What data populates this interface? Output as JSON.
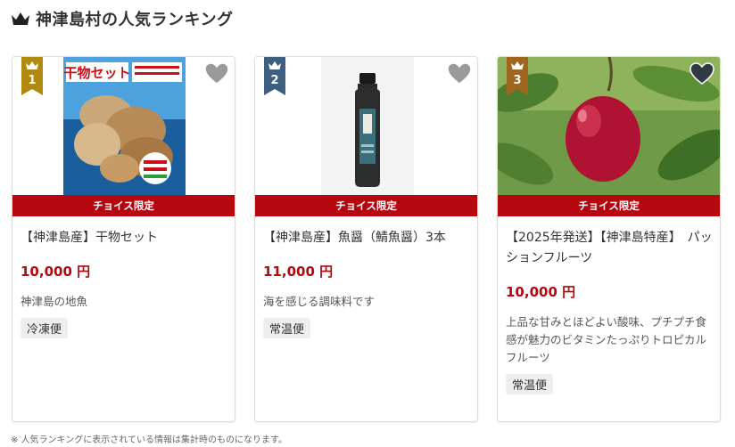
{
  "heading": "神津島村の人気ランキング",
  "ribbon_label": "チョイス限定",
  "products": [
    {
      "rank": "1",
      "rank_color": "#b08a0e",
      "title": "【神津島産】干物セット",
      "price": "10,000 円",
      "description": "神津島の地魚",
      "tag": "冷凍便",
      "image_text": "干物セット"
    },
    {
      "rank": "2",
      "rank_color": "#3e5f7f",
      "title": "【神津島産】魚醤（鯖魚醤）3本",
      "price": "11,000 円",
      "description": "海を感じる調味料です",
      "tag": "常温便"
    },
    {
      "rank": "3",
      "rank_color": "#a0651f",
      "title": "【2025年発送】【神津島特産】　パッションフルーツ",
      "price": "10,000 円",
      "description": "上品な甘みとほどよい酸味、プチプチ食感が魅力のビタミンたっぷりトロピカルフルーツ",
      "tag": "常温便"
    }
  ],
  "footnote": "※ 人気ランキングに表示されている情報は集計時のものになります。"
}
